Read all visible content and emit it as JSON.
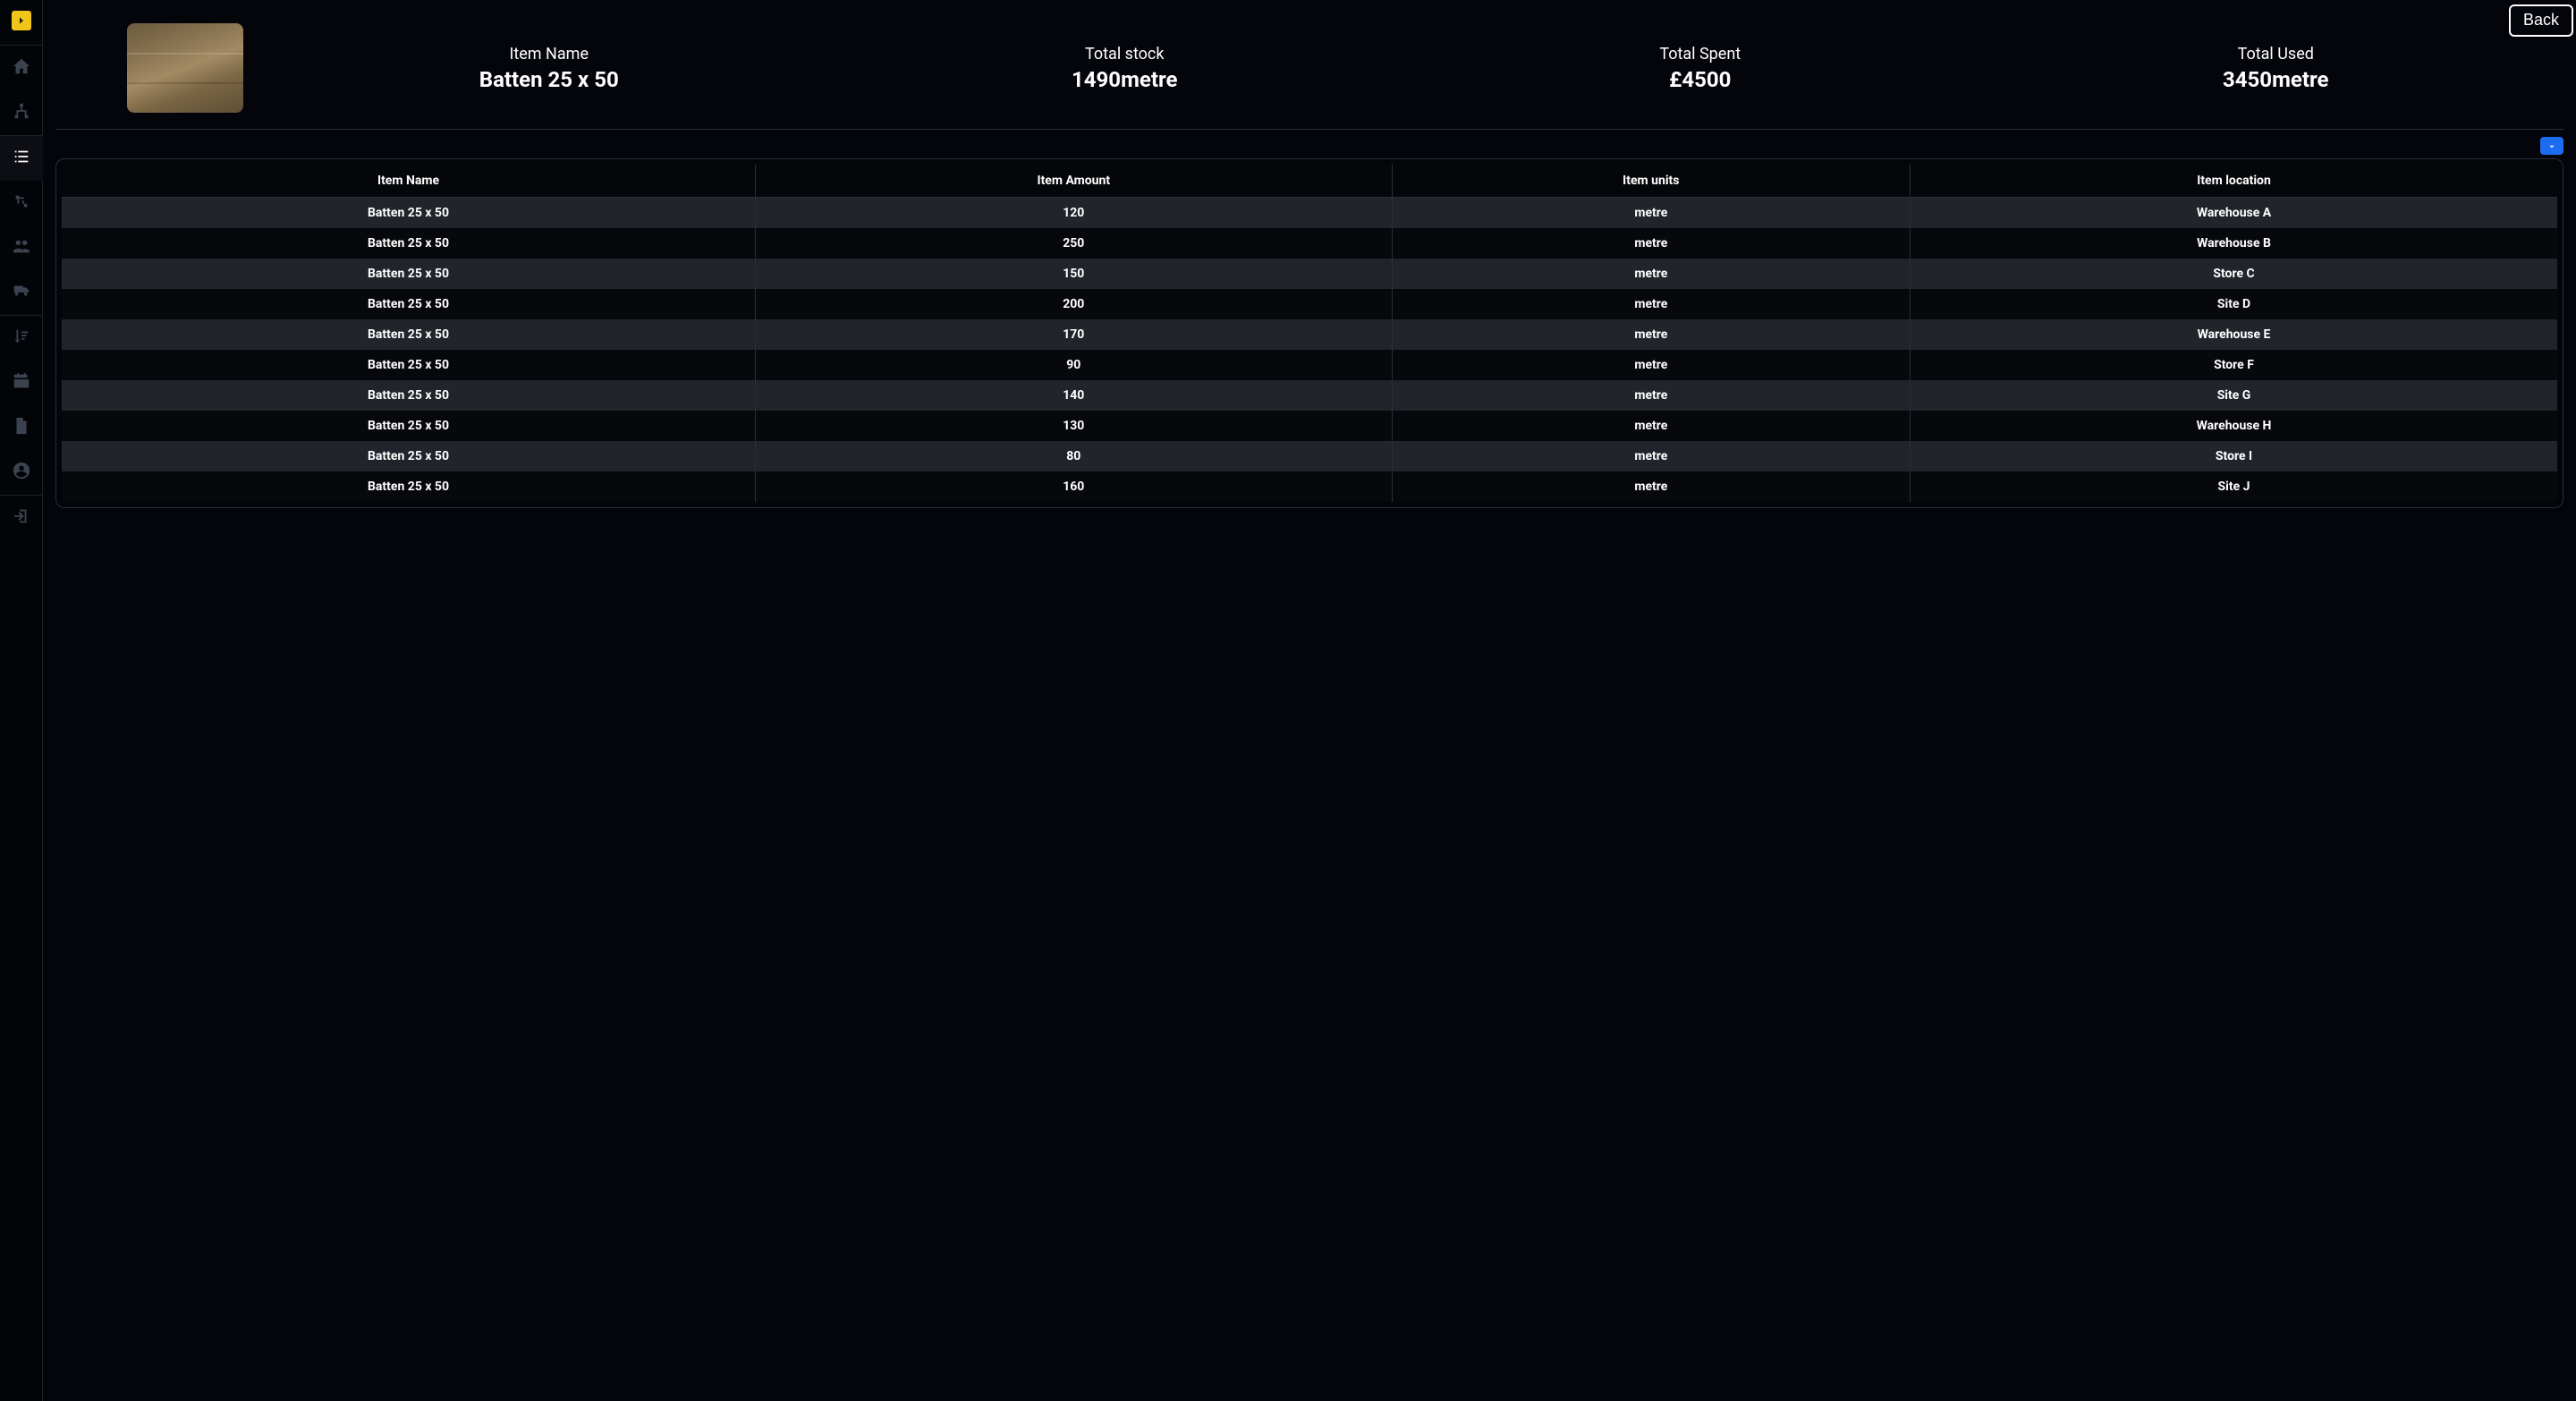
{
  "back_label": "Back",
  "summary": {
    "item_name_label": "Item Name",
    "item_name_value": "Batten 25 x 50",
    "total_stock_label": "Total stock",
    "total_stock_value": "1490metre",
    "total_spent_label": "Total Spent",
    "total_spent_value": "£4500",
    "total_used_label": "Total Used",
    "total_used_value": "3450metre"
  },
  "table": {
    "headers": [
      "Item Name",
      "Item Amount",
      "Item units",
      "Item location"
    ],
    "rows": [
      {
        "name": "Batten 25 x 50",
        "amount": "120",
        "units": "metre",
        "location": "Warehouse A"
      },
      {
        "name": "Batten 25 x 50",
        "amount": "250",
        "units": "metre",
        "location": "Warehouse B"
      },
      {
        "name": "Batten 25 x 50",
        "amount": "150",
        "units": "metre",
        "location": "Store C"
      },
      {
        "name": "Batten 25 x 50",
        "amount": "200",
        "units": "metre",
        "location": "Site D"
      },
      {
        "name": "Batten 25 x 50",
        "amount": "170",
        "units": "metre",
        "location": "Warehouse E"
      },
      {
        "name": "Batten 25 x 50",
        "amount": "90",
        "units": "metre",
        "location": "Store F"
      },
      {
        "name": "Batten 25 x 50",
        "amount": "140",
        "units": "metre",
        "location": "Site G"
      },
      {
        "name": "Batten 25 x 50",
        "amount": "130",
        "units": "metre",
        "location": "Warehouse H"
      },
      {
        "name": "Batten 25 x 50",
        "amount": "80",
        "units": "metre",
        "location": "Store I"
      },
      {
        "name": "Batten 25 x 50",
        "amount": "160",
        "units": "metre",
        "location": "Site J"
      }
    ]
  },
  "sidebar": {
    "items": [
      {
        "name": "toggle",
        "icon": "chevron-right-icon"
      },
      {
        "name": "home",
        "icon": "home-icon"
      },
      {
        "name": "sitemap",
        "icon": "sitemap-icon"
      },
      {
        "name": "list",
        "icon": "list-icon",
        "active": true
      },
      {
        "name": "flow",
        "icon": "flow-icon"
      },
      {
        "name": "users",
        "icon": "users-icon"
      },
      {
        "name": "delivery",
        "icon": "truck-icon"
      },
      {
        "name": "sort",
        "icon": "sort-icon"
      },
      {
        "name": "calendar",
        "icon": "calendar-icon"
      },
      {
        "name": "document",
        "icon": "document-icon"
      },
      {
        "name": "account",
        "icon": "user-circle-icon"
      },
      {
        "name": "logout",
        "icon": "logout-icon"
      }
    ]
  }
}
